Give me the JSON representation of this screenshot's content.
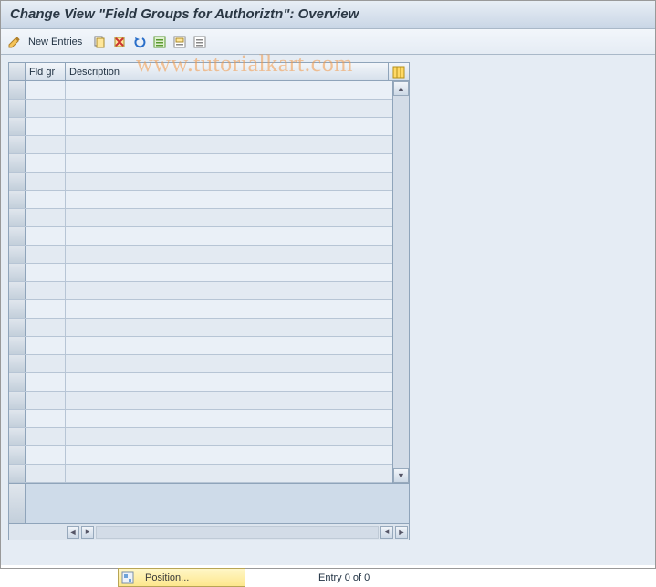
{
  "title": "Change View \"Field Groups for Authoriztn\": Overview",
  "toolbar": {
    "new_entries_label": "New Entries",
    "icons": {
      "edit": "edit-icon",
      "copy": "copy-icon",
      "delete": "delete-icon",
      "undo": "undo-icon",
      "select_all": "select-all-icon",
      "select_block": "select-block-icon",
      "deselect": "deselect-icon"
    }
  },
  "table": {
    "columns": {
      "fld_gr": "Fld gr",
      "description": "Description"
    },
    "row_count": 22,
    "rows": []
  },
  "footer": {
    "position_label": "Position...",
    "entry_text": "Entry 0 of 0"
  },
  "watermark": "www.tutorialkart.com"
}
